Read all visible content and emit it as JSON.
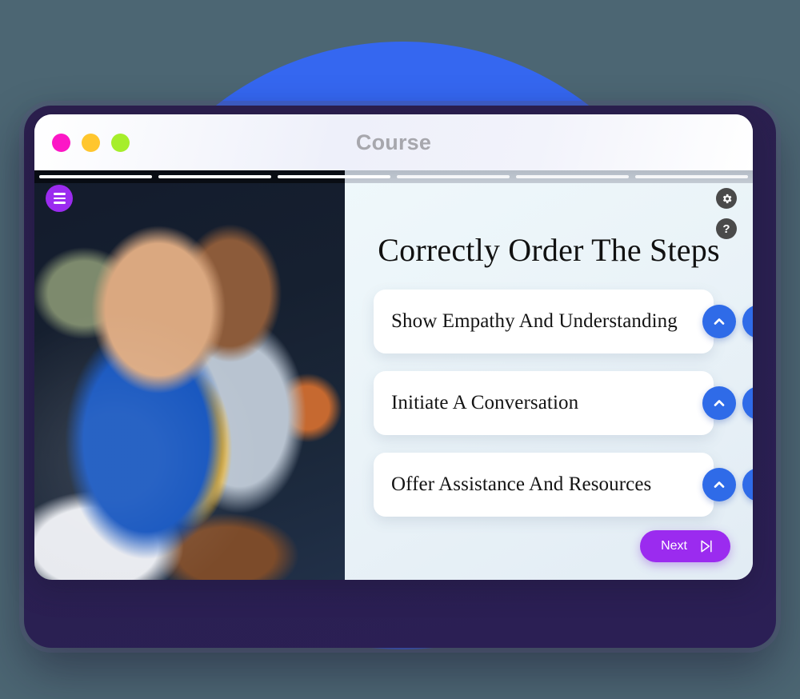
{
  "window": {
    "title": "Course",
    "traffic_lights": [
      {
        "name": "close",
        "color": "#FC17C6"
      },
      {
        "name": "minimize",
        "color": "#FFC62E"
      },
      {
        "name": "maximize",
        "color": "#A6EE2B"
      }
    ]
  },
  "progress": {
    "total_segments": 6,
    "completed_segments": 3,
    "segments": [
      {
        "state": "done"
      },
      {
        "state": "done"
      },
      {
        "state": "done"
      },
      {
        "state": "todo"
      },
      {
        "state": "todo"
      },
      {
        "state": "todo"
      }
    ]
  },
  "toolbar": {
    "menu_icon": "hamburger-icon",
    "settings_icon": "gear-icon",
    "help_icon": "question-mark-icon"
  },
  "main": {
    "heading": "Correctly Order The Steps",
    "items": [
      {
        "label": "Show Empathy And Understanding",
        "move_up": "move-up",
        "move_down": "move-down"
      },
      {
        "label": "Initiate A Conversation",
        "move_up": "move-up",
        "move_down": "move-down"
      },
      {
        "label": "Offer Assistance And Resources",
        "move_up": "move-up",
        "move_down": "move-down"
      }
    ],
    "next_label": "Next",
    "next_icon": "skip-forward-icon"
  },
  "colors": {
    "page_background": "#4C6673",
    "blob_blue": "#3567F0",
    "frame_purple": "#2C1F4E",
    "accent_purple": "#9B2BEF",
    "accent_blue": "#2F6BE8",
    "panel_background": "#EFF8FB",
    "card_background": "#FFFFFF",
    "title_text": "#A7A7AD"
  }
}
